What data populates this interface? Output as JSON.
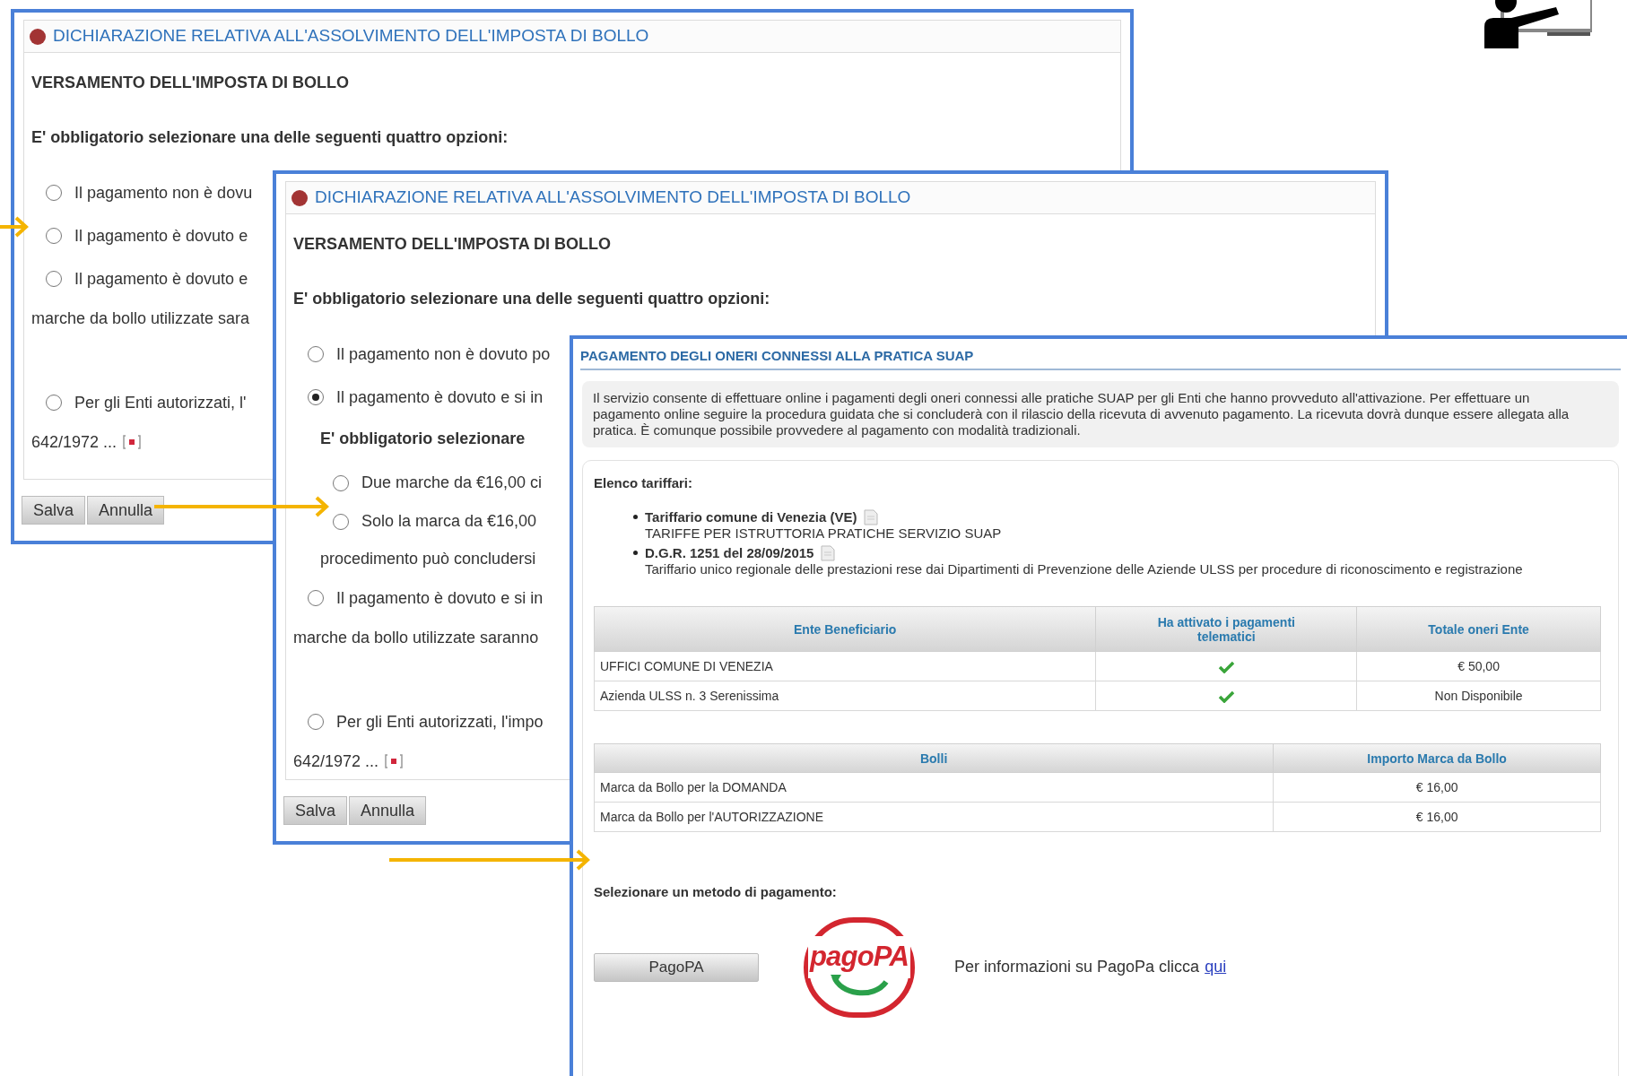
{
  "declaration_windows": [
    {
      "title": "DICHIARAZIONE RELATIVA ALL'ASSOLVIMENTO DELL'IMPOSTA DI BOLLO",
      "section": "VERSAMENTO DELL'IMPOSTA DI BOLLO",
      "instruction": "E' obbligatorio selezionare una delle seguenti quattro opzioni:",
      "options": [
        {
          "label": "Il pagamento non è dovu",
          "selected": false
        },
        {
          "label": "Il pagamento è dovuto e",
          "selected": false
        },
        {
          "label": "Il pagamento è dovuto e",
          "selected": false,
          "continuation": "marche da bollo utilizzate sara"
        },
        {
          "label": "Per gli Enti autorizzati, l'",
          "selected": false,
          "continuation": "642/1972 ...",
          "note": true
        }
      ],
      "buttons": [
        "Salva",
        "Annulla"
      ]
    },
    {
      "title": "DICHIARAZIONE RELATIVA ALL'ASSOLVIMENTO DELL'IMPOSTA DI BOLLO",
      "section": "VERSAMENTO DELL'IMPOSTA DI BOLLO",
      "instruction": "E' obbligatorio selezionare una delle seguenti quattro opzioni:",
      "options": [
        {
          "label": "Il pagamento non è dovuto po",
          "selected": false
        },
        {
          "label": "Il pagamento è dovuto e si in",
          "selected": true,
          "sub_instruction": "E' obbligatorio selezionare",
          "sub_options": [
            {
              "label": "Due marche da €16,00 ci",
              "selected": false
            },
            {
              "label": "Solo la marca da €16,00",
              "selected": false,
              "continuation": "procedimento può concludersi"
            }
          ]
        },
        {
          "label": "Il pagamento è dovuto e si in",
          "selected": false,
          "continuation": "marche da bollo utilizzate saranno"
        },
        {
          "label": "Per gli Enti autorizzati, l'impo",
          "selected": false,
          "continuation": "642/1972 ...",
          "note": true
        }
      ],
      "buttons": [
        "Salva",
        "Annulla"
      ]
    }
  ],
  "payment_window": {
    "title": "PAGAMENTO DEGLI ONERI CONNESSI ALLA PRATICA SUAP",
    "info": "Il servizio consente di effettuare online i pagamenti degli oneri connessi alle pratiche SUAP per gli Enti che hanno provveduto all'attivazione. Per effettuare un pagamento online seguire la procedura guidata che si concluderà con il rilascio della ricevuta di avvenuto pagamento. La ricevuta dovrà dunque essere allegata alla pratica. È comunque possibile provvedere al pagamento con modalità tradizionali.",
    "tariffs_heading": "Elenco tariffari:",
    "tariffs": [
      {
        "name": "Tariffario comune di Venezia (VE)",
        "description": "TARIFFE PER ISTRUTTORIA PRATICHE SERVIZIO SUAP"
      },
      {
        "name": "D.G.R. 1251 del 28/09/2015",
        "description": "Tariffario unico regionale delle prestazioni rese dai Dipartimenti di Prevenzione delle Aziende ULSS per procedure di riconoscimento e registrazione"
      }
    ],
    "entities_table": {
      "columns": [
        "Ente Beneficiario",
        "Ha attivato i pagamenti telematici",
        "Totale oneri Ente"
      ],
      "rows": [
        {
          "entity": "UFFICI COMUNE DI VENEZIA",
          "activated": true,
          "total": "€ 50,00"
        },
        {
          "entity": "Azienda ULSS n. 3 Serenissima",
          "activated": true,
          "total": "Non Disponibile"
        }
      ]
    },
    "stamps_table": {
      "columns": [
        "Bolli",
        "Importo Marca da Bollo"
      ],
      "rows": [
        {
          "stamp": "Marca da Bollo per la DOMANDA",
          "amount": "€ 16,00"
        },
        {
          "stamp": "Marca da Bollo per l'AUTORIZZAZIONE",
          "amount": "€ 16,00"
        }
      ]
    },
    "method_heading": "Selezionare un metodo di pagamento:",
    "method_button": "PagoPA",
    "logo_text": "pagoPA",
    "info_text": "Per informazioni su PagoPa clicca",
    "info_link": "qui"
  }
}
